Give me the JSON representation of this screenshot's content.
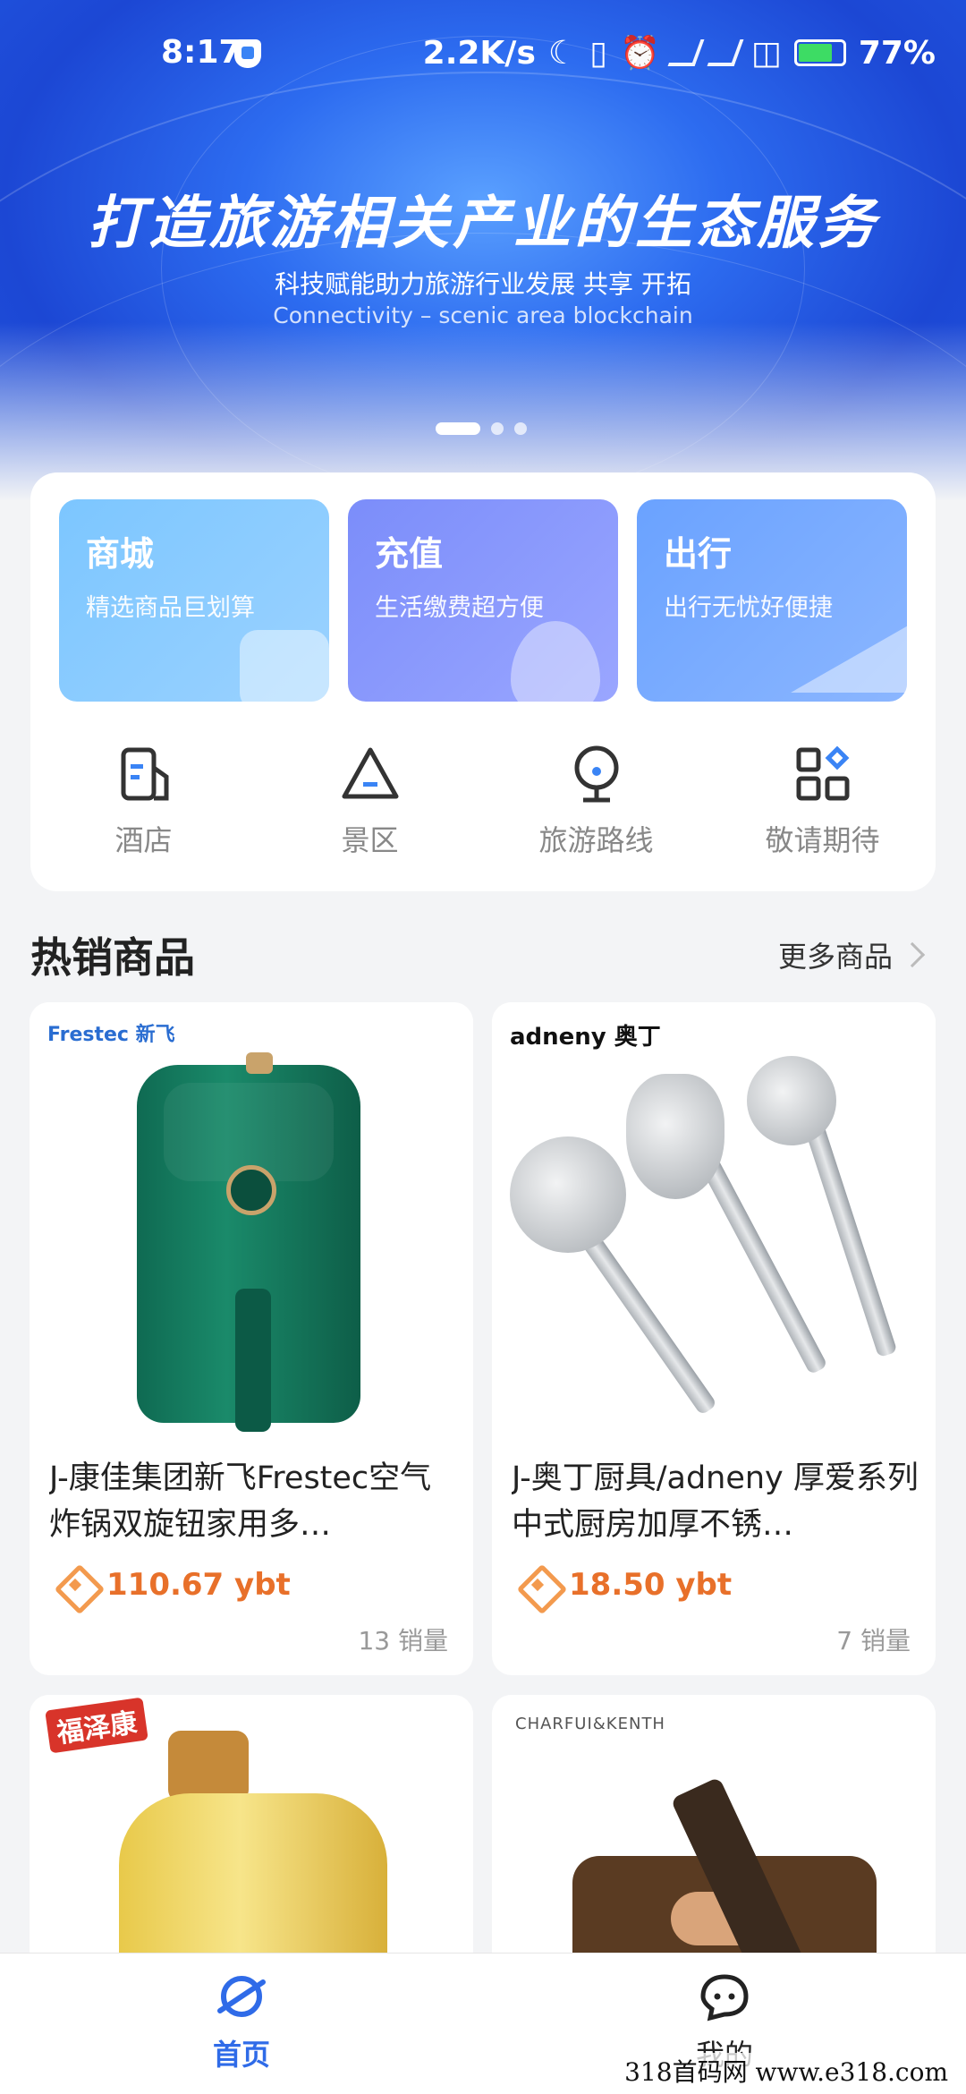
{
  "status_bar": {
    "time": "8:17",
    "network_speed": "2.2K/s",
    "battery": "77%"
  },
  "banner": {
    "title": "打造旅游相关产业的生态服务",
    "subtitle": "科技赋能助力旅游行业发展 共享 开拓",
    "subtitle_en": "Connectivity – scenic area blockchain",
    "slides": 3,
    "active_slide": 1
  },
  "quick_tiles": [
    {
      "title": "商城",
      "subtitle": "精选商品巨划算"
    },
    {
      "title": "充值",
      "subtitle": "生活缴费超方便"
    },
    {
      "title": "出行",
      "subtitle": "出行无忧好便捷"
    }
  ],
  "nav_icons": [
    {
      "label": "酒店",
      "icon": "hotel-icon"
    },
    {
      "label": "景区",
      "icon": "scenic-area-icon"
    },
    {
      "label": "旅游路线",
      "icon": "route-pin-icon"
    },
    {
      "label": "敬请期待",
      "icon": "grid-apps-icon"
    }
  ],
  "section": {
    "title": "热销商品",
    "more": "更多商品"
  },
  "products": [
    {
      "brand": "Frestec 新飞",
      "name": " J-康佳集团新飞Frestec空气炸锅双旋钮家用多…",
      "price": "110.67 ybt",
      "sales": "13 销量"
    },
    {
      "brand": "adneny 奥丁",
      "name": "J-奥丁厨具/adneny 厚爱系列 中式厨房加厚不锈…",
      "price": "18.50 ybt",
      "sales": "7 销量"
    },
    {
      "brand": "福泽康",
      "name": "",
      "price": "",
      "sales": ""
    },
    {
      "brand": "CHARFUI&KENTH",
      "name": "",
      "price": "",
      "sales": ""
    }
  ],
  "tabbar": {
    "home": "首页",
    "mine": "我的"
  },
  "watermark": "318首码网   www.e318.com",
  "colors": {
    "accent": "#2f6be8",
    "price": "#e8702a"
  }
}
